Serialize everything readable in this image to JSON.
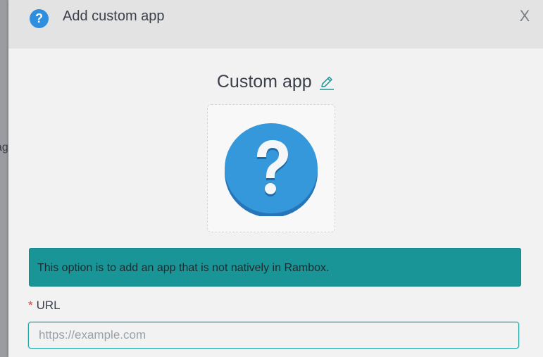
{
  "dialog": {
    "title": "Add custom app",
    "close_label": "X",
    "header_icon_glyph": "?"
  },
  "app": {
    "name": "Custom app",
    "icon_name": "question-mark-icon"
  },
  "info": {
    "message": "This option is to add an app that is not natively in Rambox."
  },
  "url_field": {
    "required_marker": "*",
    "label": "URL",
    "value": "",
    "placeholder": "https://example.com"
  },
  "background": {
    "partial_text": "ag"
  },
  "colors": {
    "accent": "#1a9597",
    "icon_blue": "#2f8fdf",
    "required": "#e23b3b"
  }
}
